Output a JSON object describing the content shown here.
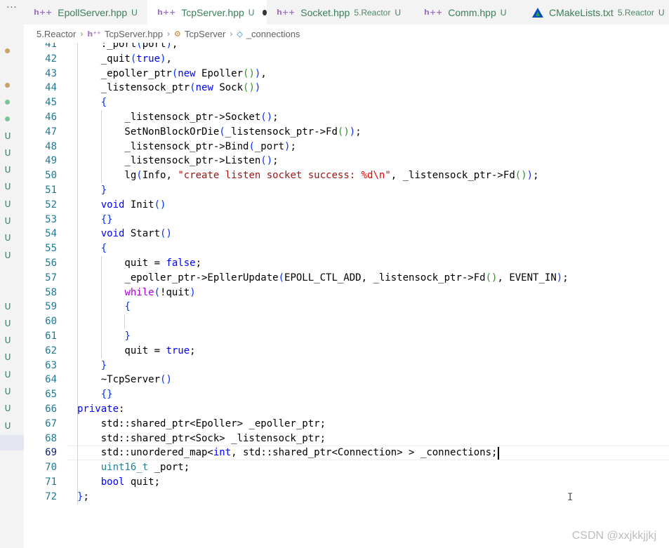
{
  "tabs": [
    {
      "name": "EpollServer.hpp",
      "desc": "",
      "state": "U",
      "active": false,
      "modified": false,
      "icon": "cpp-header-icon"
    },
    {
      "name": "TcpServer.hpp",
      "desc": "",
      "state": "U",
      "active": true,
      "modified": true,
      "icon": "cpp-header-icon"
    },
    {
      "name": "Socket.hpp",
      "desc": "5.Reactor",
      "state": "U",
      "active": false,
      "modified": false,
      "icon": "cpp-header-icon"
    },
    {
      "name": "Comm.hpp",
      "desc": "",
      "state": "U",
      "active": false,
      "modified": false,
      "icon": "cpp-header-icon"
    },
    {
      "name": "CMakeLists.txt",
      "desc": "5.Reactor",
      "state": "U",
      "active": false,
      "modified": false,
      "icon": "cmake-icon"
    }
  ],
  "tab_icon_glyph": "h++",
  "breadcrumb": [
    "5.Reactor",
    "TcpServer.hpp",
    "TcpServer",
    "_connections"
  ],
  "activity": {
    "more": "···",
    "marks": [
      "",
      "",
      "",
      "",
      "",
      "U",
      "U",
      "U",
      "U",
      "U",
      "U",
      "U",
      "U",
      "",
      "",
      "U",
      "U",
      "U",
      "U",
      "U",
      "U",
      "U",
      "U"
    ]
  },
  "editor": {
    "first_line": 41,
    "current_line": 69,
    "lines": [
      "    :_port(port),",
      "    _quit(true),",
      "    _epoller_ptr(new Epoller()),",
      "    _listensock_ptr(new Sock())",
      "    {",
      "        _listensock_ptr->Socket();",
      "        SetNonBlockOrDie(_listensock_ptr->Fd());",
      "        _listensock_ptr->Bind(_port);",
      "        _listensock_ptr->Listen();",
      "        lg(Info, \"create listen socket success: %d\\n\", _listensock_ptr->Fd());",
      "    }",
      "    void Init()",
      "    {}",
      "    void Start()",
      "    {",
      "        quit = false;",
      "        _epoller_ptr->EpllerUpdate(EPOLL_CTL_ADD, _listensock_ptr->Fd(), EVENT_IN);",
      "        while(!quit)",
      "        {",
      "",
      "        }",
      "        quit = true;",
      "    }",
      "    ~TcpServer()",
      "    {}",
      "private:",
      "    std::shared_ptr<Epoller> _epoller_ptr;",
      "    std::shared_ptr<Sock> _listensock_ptr;",
      "    std::unordered_map<int, std::shared_ptr<Connection> > _connections;",
      "    uint16_t _port;",
      "    bool quit;",
      "};"
    ]
  },
  "watermark": "CSDN @xxjkkjjkj",
  "colors": {
    "keyword": "#0000ff",
    "control": "#af00db",
    "type": "#267f99",
    "string": "#a31515",
    "line_number": "#237893",
    "git_untracked": "#3b7f58"
  }
}
